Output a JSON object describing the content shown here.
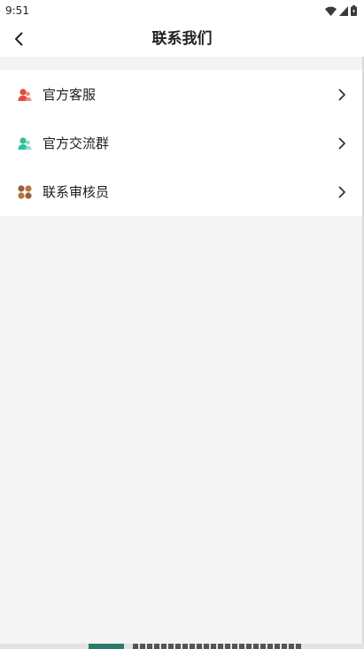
{
  "status_bar": {
    "time": "9:51",
    "icons": [
      "wifi-icon",
      "signal-icon",
      "battery-icon"
    ]
  },
  "header": {
    "back_icon": "chevron-left-icon",
    "title": "联系我们"
  },
  "menu": {
    "items": [
      {
        "label": "官方客服",
        "icon": "customer-service-icon",
        "icon_color": "#e24a3b"
      },
      {
        "label": "官方交流群",
        "icon": "user-group-icon",
        "icon_color": "#2fbf9b"
      },
      {
        "label": "联系审核员",
        "icon": "grid-circles-icon",
        "icon_color": "#9c5e3a"
      }
    ],
    "chevron_icon": "chevron-right-icon"
  },
  "colors": {
    "background": "#f4f4f4",
    "card": "#ffffff",
    "title_text": "#222222"
  }
}
